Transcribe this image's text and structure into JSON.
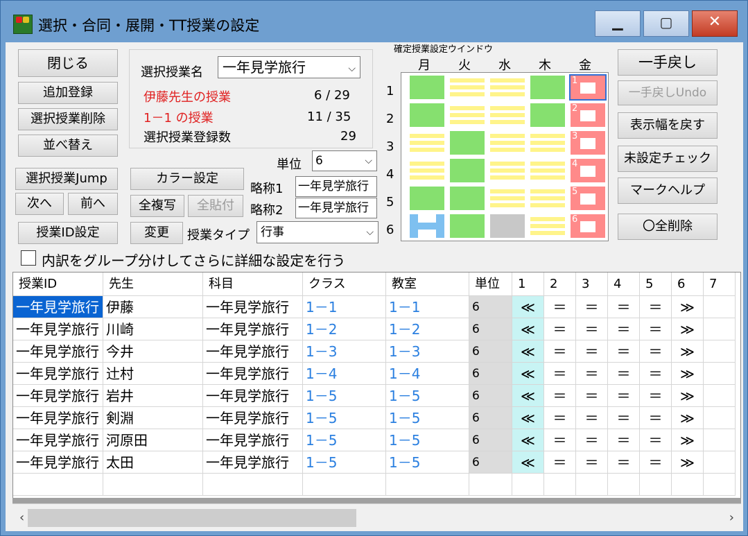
{
  "window": {
    "title": "選択・合同・展開・TT授業の設定",
    "controls": {
      "minimize": "▁",
      "maximize": "▢",
      "close": "✕"
    }
  },
  "left_buttons": {
    "close": "閉じる",
    "add": "追加登録",
    "delete": "選択授業削除",
    "sort": "並べ替え",
    "jump": "選択授業Jump",
    "next": "次へ",
    "prev": "前へ",
    "class_id": "授業ID設定"
  },
  "info_panel": {
    "selected_label": "選択授業名",
    "selected_value": "一年見学旅行",
    "teacher_line": "伊藤先生の授業",
    "teacher_count": "6 / 29",
    "class_line": "1－1 の授業",
    "class_count": "11 / 35",
    "registered_label": "選択授業登録数",
    "registered_count": "29"
  },
  "mid_controls": {
    "color_button": "カラー設定",
    "copy_all": "全複写",
    "paste_all": "全貼付",
    "change": "変更",
    "type_label": "授業タイプ",
    "type_value": "行事",
    "unit_label": "単位",
    "unit_value": "6",
    "abbr1_label": "略称1",
    "abbr1_value": "一年見学旅行",
    "abbr2_label": "略称2",
    "abbr2_value": "一年見学旅行"
  },
  "timetable": {
    "title": "確定授業設定ウインドウ",
    "days": [
      "月",
      "火",
      "水",
      "木",
      "金"
    ],
    "periods": [
      "1",
      "2",
      "3",
      "4",
      "5",
      "6"
    ],
    "cells": [
      [
        "g",
        "y",
        "y",
        "g",
        "r"
      ],
      [
        "g",
        "y",
        "y",
        "g",
        "r"
      ],
      [
        "y",
        "g",
        "y",
        "y",
        "r"
      ],
      [
        "y",
        "g",
        "y",
        "y",
        "r"
      ],
      [
        "g",
        "g",
        "y",
        "y",
        "r"
      ],
      [
        "b",
        "g",
        "gray",
        "y",
        "r"
      ]
    ],
    "red_labels": [
      "1",
      "2",
      "3",
      "4",
      "5",
      "6"
    ]
  },
  "right_buttons": {
    "undo": "一手戻し",
    "redo": "一手戻しUndo",
    "reset_width": "表示幅を戻す",
    "check": "未設定チェック",
    "mark_help": "マークヘルプ",
    "delete_all": "〇全削除"
  },
  "group_checkbox": "内訳をグループ分けしてさらに詳細な設定を行う",
  "table": {
    "headers": [
      "授業ID",
      "先生",
      "科目",
      "クラス",
      "教室",
      "単位",
      "1",
      "2",
      "3",
      "4",
      "5",
      "6",
      "7"
    ],
    "rows": [
      {
        "id": "一年見学旅行",
        "teacher": "伊藤",
        "subject": "一年見学旅行",
        "cls": "1－1",
        "room": "1－1",
        "unit": "6",
        "p": [
          "≪",
          "＝",
          "＝",
          "＝",
          "＝",
          "≫",
          ""
        ]
      },
      {
        "id": "一年見学旅行",
        "teacher": "川崎",
        "subject": "一年見学旅行",
        "cls": "1－2",
        "room": "1－2",
        "unit": "6",
        "p": [
          "≪",
          "＝",
          "＝",
          "＝",
          "＝",
          "≫",
          ""
        ]
      },
      {
        "id": "一年見学旅行",
        "teacher": "今井",
        "subject": "一年見学旅行",
        "cls": "1－3",
        "room": "1－3",
        "unit": "6",
        "p": [
          "≪",
          "＝",
          "＝",
          "＝",
          "＝",
          "≫",
          ""
        ]
      },
      {
        "id": "一年見学旅行",
        "teacher": "辻村",
        "subject": "一年見学旅行",
        "cls": "1－4",
        "room": "1－4",
        "unit": "6",
        "p": [
          "≪",
          "＝",
          "＝",
          "＝",
          "＝",
          "≫",
          ""
        ]
      },
      {
        "id": "一年見学旅行",
        "teacher": "岩井",
        "subject": "一年見学旅行",
        "cls": "1－5",
        "room": "1－5",
        "unit": "6",
        "p": [
          "≪",
          "＝",
          "＝",
          "＝",
          "＝",
          "≫",
          ""
        ]
      },
      {
        "id": "一年見学旅行",
        "teacher": "剣淵",
        "subject": "一年見学旅行",
        "cls": "1－5",
        "room": "1－5",
        "unit": "6",
        "p": [
          "≪",
          "＝",
          "＝",
          "＝",
          "＝",
          "≫",
          ""
        ]
      },
      {
        "id": "一年見学旅行",
        "teacher": "河原田",
        "subject": "一年見学旅行",
        "cls": "1－5",
        "room": "1－5",
        "unit": "6",
        "p": [
          "≪",
          "＝",
          "＝",
          "＝",
          "＝",
          "≫",
          ""
        ]
      },
      {
        "id": "一年見学旅行",
        "teacher": "太田",
        "subject": "一年見学旅行",
        "cls": "1－5",
        "room": "1－5",
        "unit": "6",
        "p": [
          "≪",
          "＝",
          "＝",
          "＝",
          "＝",
          "≫",
          ""
        ]
      }
    ]
  },
  "scroll": {
    "left": "‹",
    "right": "›"
  }
}
